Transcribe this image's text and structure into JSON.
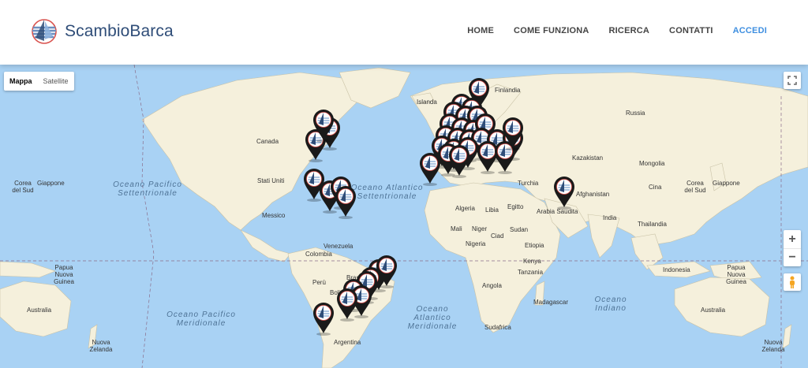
{
  "header": {
    "logo_part1": "Scambio",
    "logo_part2": "Barca",
    "nav": [
      {
        "label": "HOME"
      },
      {
        "label": "COME FUNZIONA"
      },
      {
        "label": "RICERCA"
      },
      {
        "label": "CONTATTI"
      },
      {
        "label": "ACCEDI",
        "accent": true
      }
    ]
  },
  "map": {
    "type_control": {
      "map_label": "Mappa",
      "satellite_label": "Satellite"
    },
    "zoom_in": "+",
    "zoom_out": "−",
    "countries": [
      "Finlandia",
      "Islanda",
      "Russia",
      "Canada",
      "Kazakistan",
      "Mongolia",
      "Stati Uniti",
      "Giappone",
      "Cina",
      "Turchia",
      "Afghanistan",
      "Messico",
      "Algeria",
      "Libia",
      "Egitto",
      "Arabia Saudita",
      "India",
      "Mali",
      "Niger",
      "Ciad",
      "Sudan",
      "Thailandia",
      "Venezuela",
      "Colombia",
      "Nigeria",
      "Etiopia",
      "Kenya",
      "Indonesia",
      "Papua Nuova Guinea",
      "Perù",
      "Brasile",
      "Bolivia",
      "Tanzania",
      "Angola",
      "Madagascar",
      "Australia",
      "Sudafrica",
      "Argentina",
      "Nuova Zelanda",
      "Corea del Sud"
    ],
    "oceans": [
      "Oceano Pacifico Settentrionale",
      "Oceano Atlantico Settentrionale",
      "Oceano Pacifico Meridionale",
      "Oceano Atlantico Meridionale",
      "Oceano Indiano"
    ],
    "colors": {
      "water": "#a9d2f4",
      "land": "#f5f0dc",
      "pin": "#1a1a1a",
      "accent": "#3f8fe0"
    }
  }
}
